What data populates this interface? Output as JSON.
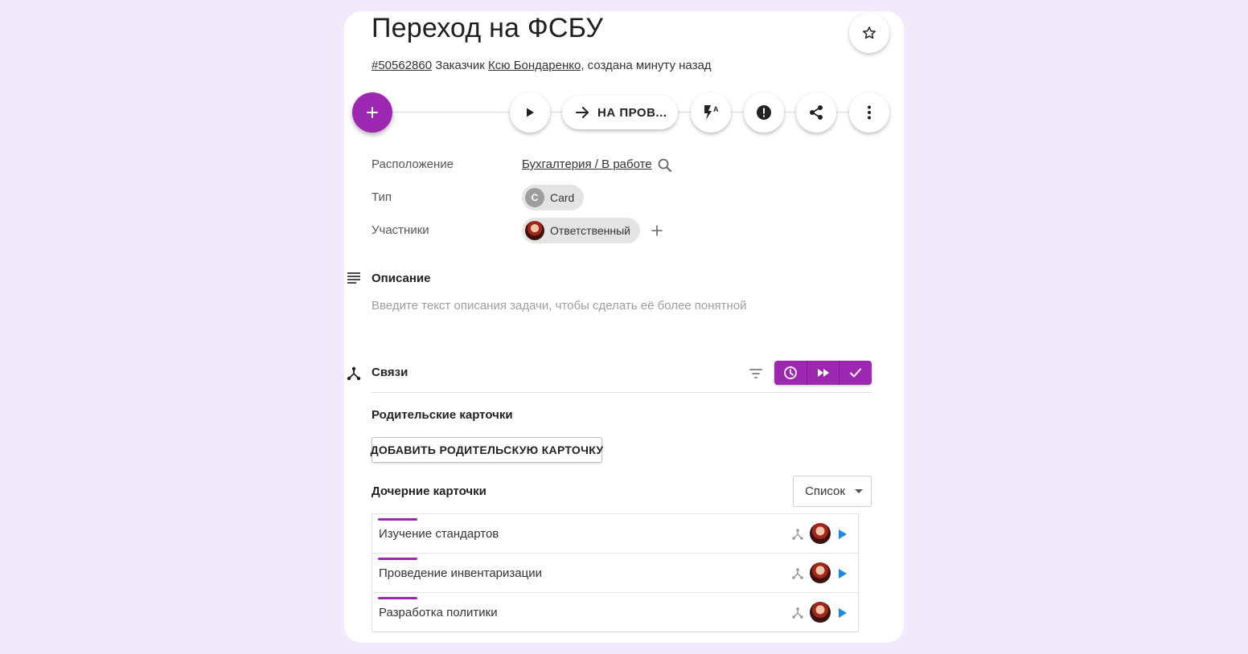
{
  "card": {
    "title": "Переход на ФСБУ",
    "id_link": "#50562860",
    "customer_prefix": "Заказчик",
    "customer_name": "Ксю Бондаренко",
    "created_suffix": ", создана минуту назад"
  },
  "toolbar": {
    "add_icon": "plus-icon",
    "play_icon": "play-icon",
    "transition_label": "НА ПРОВ...",
    "transition_icon": "arrow-right-icon",
    "flash_icon": "flash-auto-icon",
    "priority_icon": "exclamation-circle-icon",
    "share_icon": "share-icon",
    "more_icon": "more-vertical-icon",
    "star_icon": "star-outline-icon"
  },
  "props": {
    "location_label": "Расположение",
    "location_value": "Бухгалтерия / В работе",
    "type_label": "Тип",
    "type_letter": "C",
    "type_value": "Card",
    "participants_label": "Участники",
    "participant_role": "Ответственный"
  },
  "description": {
    "title": "Описание",
    "placeholder": "Введите текст описания задачи, чтобы сделать её более понятной"
  },
  "relations": {
    "title": "Связи",
    "parent_title": "Родительские карточки",
    "add_parent_label": "ДОБАВИТЬ РОДИТЕЛЬСКУЮ КАРТОЧКУ",
    "children_title": "Дочерние карточки",
    "view_mode": "Список",
    "children": [
      {
        "name": "Изучение стандартов"
      },
      {
        "name": "Проведение инвентаризации"
      },
      {
        "name": "Разработка политики"
      }
    ]
  },
  "colors": {
    "accent": "#9c27b0",
    "background": "#f1eafb",
    "play_blue": "#1e88e5"
  }
}
